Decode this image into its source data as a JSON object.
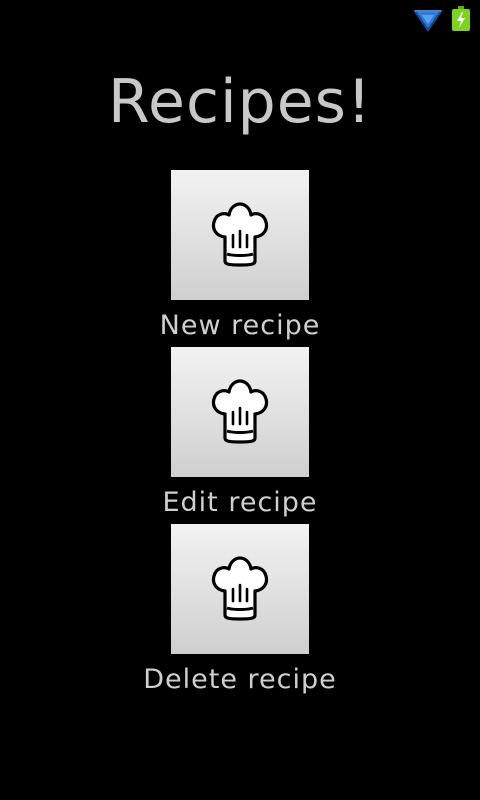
{
  "status_bar": {
    "icons": [
      "wifi-icon",
      "battery-charging-icon"
    ],
    "colors": {
      "wifi": "#2e7bd6",
      "battery": "#7ed321"
    }
  },
  "header": {
    "title": "Recipes!"
  },
  "menu": {
    "items": [
      {
        "label": "New recipe",
        "icon": "chef-hat-icon"
      },
      {
        "label": "Edit recipe",
        "icon": "chef-hat-icon"
      },
      {
        "label": "Delete recipe",
        "icon": "chef-hat-icon"
      }
    ]
  }
}
